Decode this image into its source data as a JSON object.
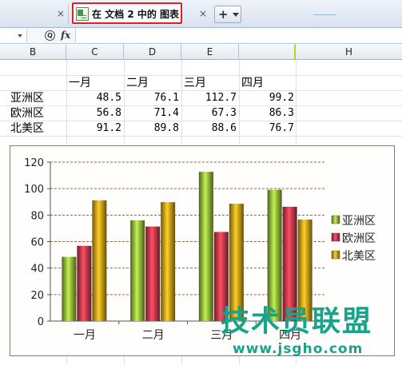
{
  "tabs": [
    {
      "label": "",
      "close": "×"
    },
    {
      "label": "在 文档 2 中的 图表",
      "close": "×",
      "active": true
    }
  ],
  "new_tab": {
    "plus": "+"
  },
  "formula_bar": {
    "zoom_glyph": "Q",
    "fx": "fx",
    "name_box": "",
    "formula": ""
  },
  "columns": [
    "B",
    "C",
    "D",
    "E",
    "",
    "H"
  ],
  "table": {
    "headers": [
      "一月",
      "二月",
      "三月",
      "四月"
    ],
    "rows": [
      {
        "label": "亚洲区",
        "values": [
          "48.5",
          "76.1",
          "112.7",
          "99.2"
        ]
      },
      {
        "label": "欧洲区",
        "values": [
          "56.8",
          "71.4",
          "67.3",
          "86.3"
        ]
      },
      {
        "label": "北美区",
        "values": [
          "91.2",
          "89.8",
          "88.6",
          "76.7"
        ]
      }
    ]
  },
  "chart_data": {
    "type": "bar",
    "categories": [
      "一月",
      "二月",
      "三月",
      "四月"
    ],
    "series": [
      {
        "name": "亚洲区",
        "values": [
          48.5,
          76.1,
          112.7,
          99.2
        ],
        "color": "#8fb43a"
      },
      {
        "name": "欧洲区",
        "values": [
          56.8,
          71.4,
          67.3,
          86.3
        ],
        "color": "#c0394a"
      },
      {
        "name": "北美区",
        "values": [
          91.2,
          89.8,
          88.6,
          76.7
        ],
        "color": "#d09a1a"
      }
    ],
    "ylim": [
      0,
      120
    ],
    "yticks": [
      0,
      20,
      40,
      60,
      80,
      100,
      120
    ],
    "grid": true,
    "legend": "right",
    "title": "",
    "xlabel": "",
    "ylabel": ""
  },
  "watermark": {
    "main": "技术员联盟",
    "url": "www.jsgho.com",
    "color": "#16a58b"
  }
}
